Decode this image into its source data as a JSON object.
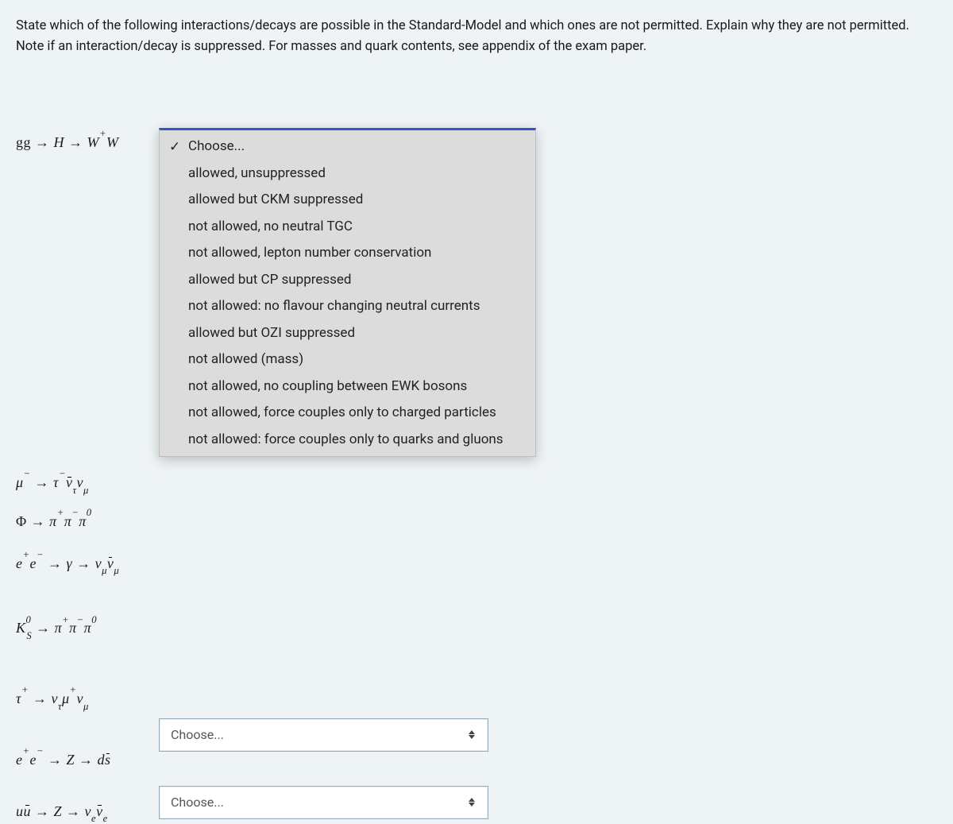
{
  "question": "State which of the following interactions/decays  are possible in the Standard-Model and which ones are not permitted. Explain why they are not permitted. Note if an interaction/decay is suppressed.  For masses and quark contents, see appendix of the exam paper.",
  "options": {
    "placeholder": "Choose...",
    "list": [
      "Choose...",
      "allowed, unsuppressed",
      "allowed but CKM suppressed",
      "not allowed, no neutral TGC",
      "not allowed, lepton number conservation",
      "allowed but CP suppressed",
      "not allowed: no flavour changing neutral currents",
      "allowed but OZI suppressed",
      "not allowed (mass)",
      "not allowed, no coupling between EWK bosons",
      "not allowed, force couples only to charged particles",
      "not allowed: force couples only to quarks and gluons"
    ]
  },
  "formulas": {
    "r1": "gg → H → W⁺W⁻",
    "r2": "μ⁻ → τ⁻ ν̄_τ ν_μ",
    "r3": "Φ → π⁺π⁻π⁰",
    "r4": "e⁺e⁻ → γ → ν_μ ν̄_μ",
    "r5": "K⁰_S → π⁺π⁻π⁰",
    "r6": "τ⁺ → ν_τ μ⁺ ν_μ",
    "r7": "e⁺e⁻ → Z → d s̄",
    "r8": "u ū → Z → ν_e ν̄_e"
  }
}
